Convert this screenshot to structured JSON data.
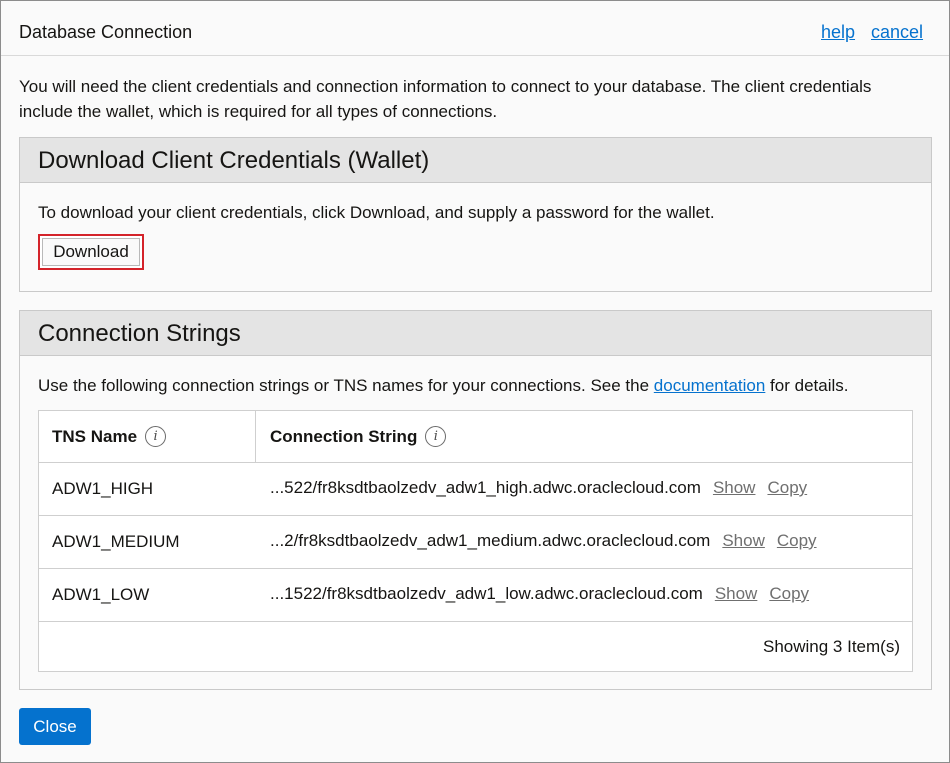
{
  "dialog": {
    "title": "Database Connection",
    "help_label": "help",
    "cancel_label": "cancel",
    "intro": "You will need the client credentials and connection information to connect to your database. The client credentials include the wallet, which is required for all types of connections."
  },
  "wallet_section": {
    "title": "Download Client Credentials (Wallet)",
    "text": "To download your client credentials, click Download, and supply a password for the wallet.",
    "download_label": "Download"
  },
  "connection_section": {
    "title": "Connection Strings",
    "text_before": "Use the following connection strings or TNS names for your connections. See the ",
    "link_label": "documentation",
    "text_after": " for details.",
    "columns": [
      "TNS Name",
      "Connection String"
    ],
    "info_icon_glyph": "i",
    "rows": [
      {
        "tns": "ADW1_HIGH",
        "conn": "...522/fr8ksdtbaolzedv_adw1_high.adwc.oraclecloud.com",
        "show": "Show",
        "copy": "Copy"
      },
      {
        "tns": "ADW1_MEDIUM",
        "conn": "...2/fr8ksdtbaolzedv_adw1_medium.adwc.oraclecloud.com",
        "show": "Show",
        "copy": "Copy"
      },
      {
        "tns": "ADW1_LOW",
        "conn": "...1522/fr8ksdtbaolzedv_adw1_low.adwc.oraclecloud.com",
        "show": "Show",
        "copy": "Copy"
      }
    ],
    "footer": "Showing 3 Item(s)"
  },
  "close_label": "Close",
  "colors": {
    "link": "#0572ce",
    "primary_button": "#0572ce",
    "highlight_border": "#d4232a",
    "section_header": "#e4e4e4"
  },
  "icons": {
    "column_info": "info-icon"
  }
}
